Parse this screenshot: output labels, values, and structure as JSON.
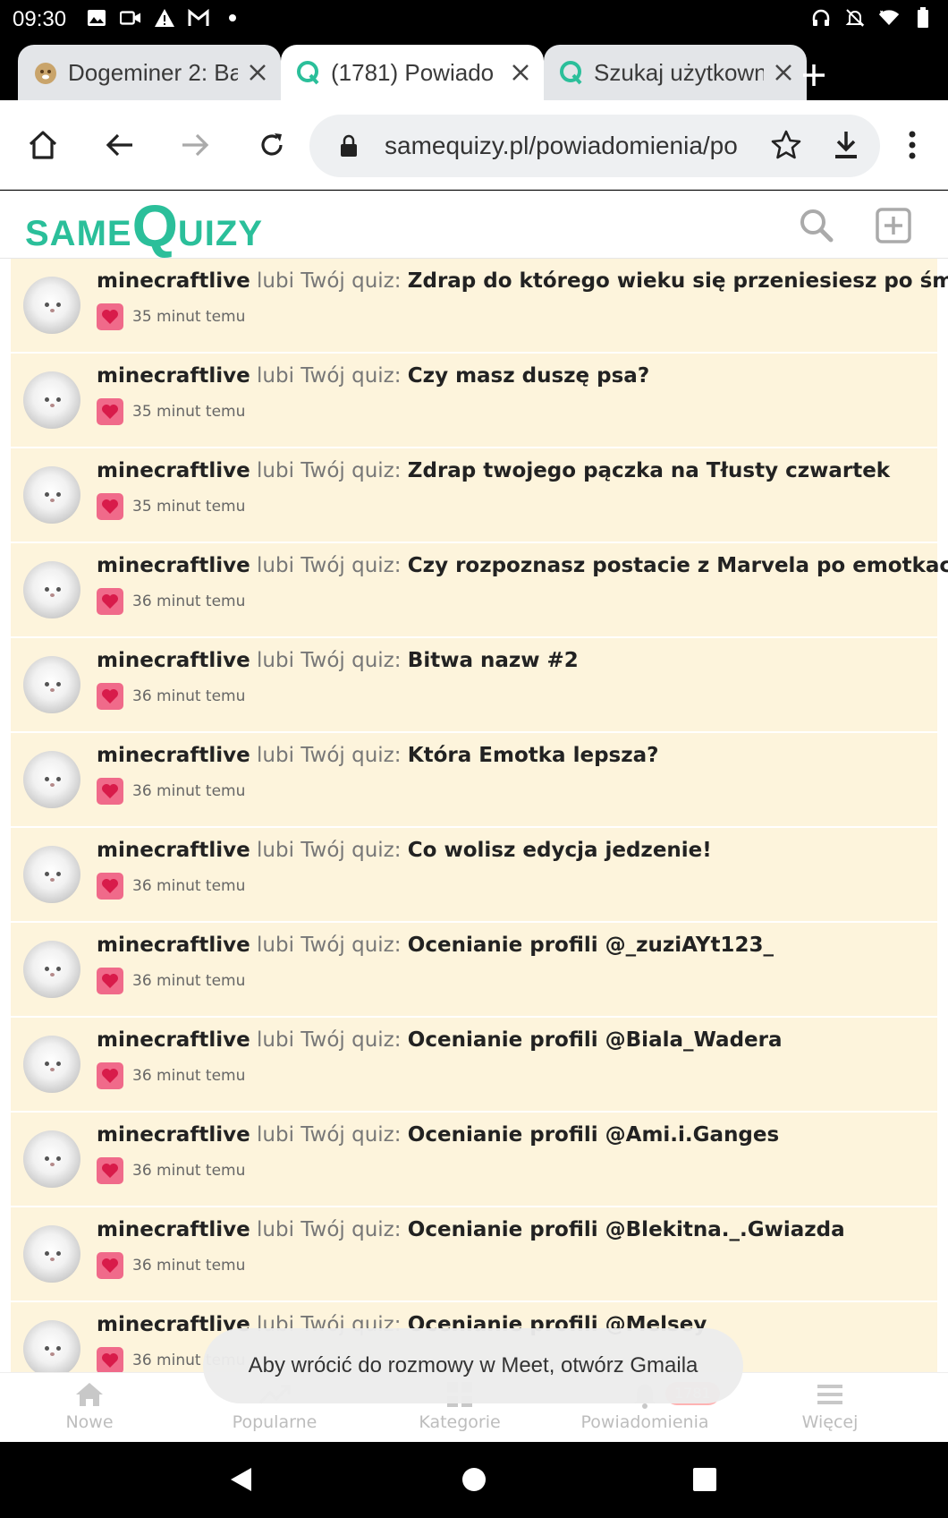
{
  "status_bar": {
    "time": "09:30"
  },
  "tabs": [
    {
      "title": "Dogeminer 2: Ba",
      "active": false
    },
    {
      "title": "(1781) Powiado",
      "active": true
    },
    {
      "title": "Szukaj użytkown",
      "active": false
    }
  ],
  "toolbar": {
    "url": "samequizy.pl/powiadomienia/po"
  },
  "site": {
    "logo_same": "SAME",
    "logo_q": "Q",
    "logo_rest": "UIZY",
    "brand_color": "#2bbf9a"
  },
  "notifications": [
    {
      "user": "minecraftlive",
      "action": "lubi Twój quiz:",
      "quiz": "Zdrap do którego wieku się przeniesiesz po śmierci!",
      "time": "35 minut temu"
    },
    {
      "user": "minecraftlive",
      "action": "lubi Twój quiz:",
      "quiz": "Czy masz duszę psa?",
      "time": "35 minut temu"
    },
    {
      "user": "minecraftlive",
      "action": "lubi Twój quiz:",
      "quiz": "Zdrap twojego pączka na Tłusty czwartek",
      "time": "35 minut temu"
    },
    {
      "user": "minecraftlive",
      "action": "lubi Twój quiz:",
      "quiz": "Czy rozpoznasz postacie z Marvela po emotkach?",
      "time": "36 minut temu"
    },
    {
      "user": "minecraftlive",
      "action": "lubi Twój quiz:",
      "quiz": "Bitwa nazw #2",
      "time": "36 minut temu"
    },
    {
      "user": "minecraftlive",
      "action": "lubi Twój quiz:",
      "quiz": "Która Emotka lepsza?",
      "time": "36 minut temu"
    },
    {
      "user": "minecraftlive",
      "action": "lubi Twój quiz:",
      "quiz": "Co wolisz edycja jedzenie!",
      "time": "36 minut temu"
    },
    {
      "user": "minecraftlive",
      "action": "lubi Twój quiz:",
      "quiz": "Ocenianie profili @_zuziAYt123_",
      "time": "36 minut temu"
    },
    {
      "user": "minecraftlive",
      "action": "lubi Twój quiz:",
      "quiz": "Ocenianie profili @Biala_Wadera",
      "time": "36 minut temu"
    },
    {
      "user": "minecraftlive",
      "action": "lubi Twój quiz:",
      "quiz": "Ocenianie profili @Ami.i.Ganges",
      "time": "36 minut temu"
    },
    {
      "user": "minecraftlive",
      "action": "lubi Twój quiz:",
      "quiz": "Ocenianie profili @Blekitna._.Gwiazda",
      "time": "36 minut temu"
    },
    {
      "user": "minecraftlive",
      "action": "lubi Twój quiz:",
      "quiz": "Ocenianie profili @Melsey",
      "time": "36 minut temu"
    }
  ],
  "bottom_nav": {
    "items": [
      {
        "label": "Nowe",
        "icon": "home-icon"
      },
      {
        "label": "Popularne",
        "icon": "trending-icon"
      },
      {
        "label": "Kategorie",
        "icon": "grid-icon"
      },
      {
        "label": "Powiadomienia",
        "icon": "bell-icon"
      },
      {
        "label": "Więcej",
        "icon": "menu-icon"
      }
    ],
    "badge": "1781"
  },
  "toast": {
    "text": "Aby wrócić do rozmowy w Meet, otwórz Gmaila"
  }
}
